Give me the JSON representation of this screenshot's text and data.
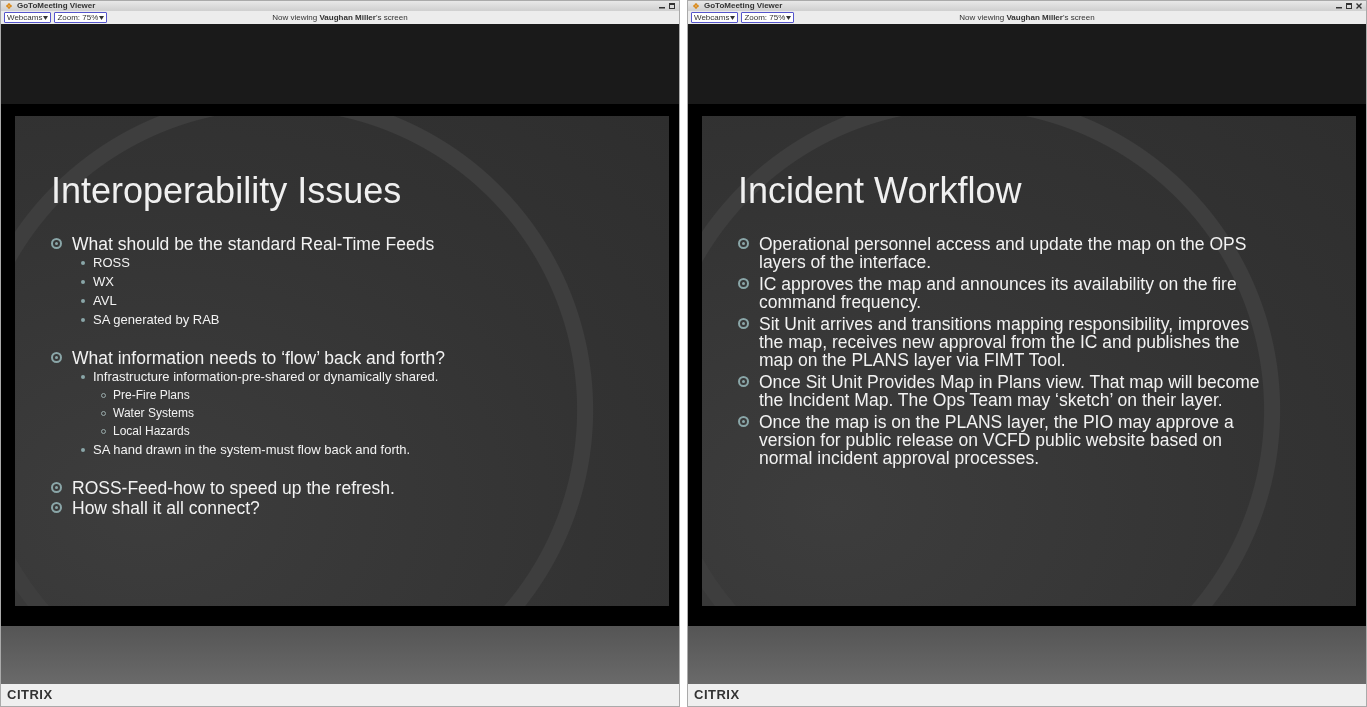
{
  "windows": [
    {
      "title": "GoToMeeting Viewer",
      "window_controls": [
        {
          "kind": "minimize"
        },
        {
          "kind": "maximize"
        }
      ],
      "menus": [
        "Webcams",
        "Zoom: 75%"
      ],
      "viewing_text": "Now viewing **Vaughan Miller**'s screen",
      "slide": {
        "title": "Interoperability Issues",
        "bullets": [
          {
            "text": "What should be the standard Real-Time Feeds",
            "children": [
              {
                "text": "ROSS"
              },
              {
                "text": "WX"
              },
              {
                "text": "AVL"
              },
              {
                "text": "SA generated by RAB"
              }
            ]
          },
          {
            "text": "What information needs to ‘flow’ back and forth?",
            "children": [
              {
                "text": "Infrastructure information-pre-shared or dynamically shared.",
                "children": [
                  {
                    "text": "Pre-Fire Plans"
                  },
                  {
                    "text": "Water Systems"
                  },
                  {
                    "text": "Local Hazards"
                  }
                ]
              },
              {
                "text": "SA hand drawn in the system-must flow back and forth."
              }
            ]
          },
          {
            "text": "ROSS-Feed-how to speed up the refresh."
          },
          {
            "text": "How shall it all connect?"
          }
        ]
      },
      "footer_logo": "CITRIX"
    },
    {
      "title": "GoToMeeting Viewer",
      "window_controls": [
        {
          "kind": "minimize"
        },
        {
          "kind": "maximize"
        },
        {
          "kind": "close"
        }
      ],
      "menus": [
        "Webcams",
        "Zoom: 75%"
      ],
      "viewing_text": "Now viewing **Vaughan Miller**'s screen",
      "slide": {
        "title": "Incident Workflow",
        "bullets": [
          {
            "text": "Operational personnel access and update the map on the OPS layers of the interface."
          },
          {
            "text": "IC approves the map and announces its availability on the fire command frequency."
          },
          {
            "text": "Sit Unit arrives and transitions mapping responsibility, improves the map, receives new approval from the IC and publishes the map on the PLANS layer via FIMT Tool."
          },
          {
            "text": "Once Sit Unit Provides Map in Plans view. That map will become the Incident Map. The Ops Team may ‘sketch’ on their layer."
          },
          {
            "text": "Once the map is on the PLANS layer, the PIO may approve a version for public release on VCFD public website based on normal incident approval processes."
          }
        ]
      },
      "footer_logo": "CITRIX"
    }
  ]
}
